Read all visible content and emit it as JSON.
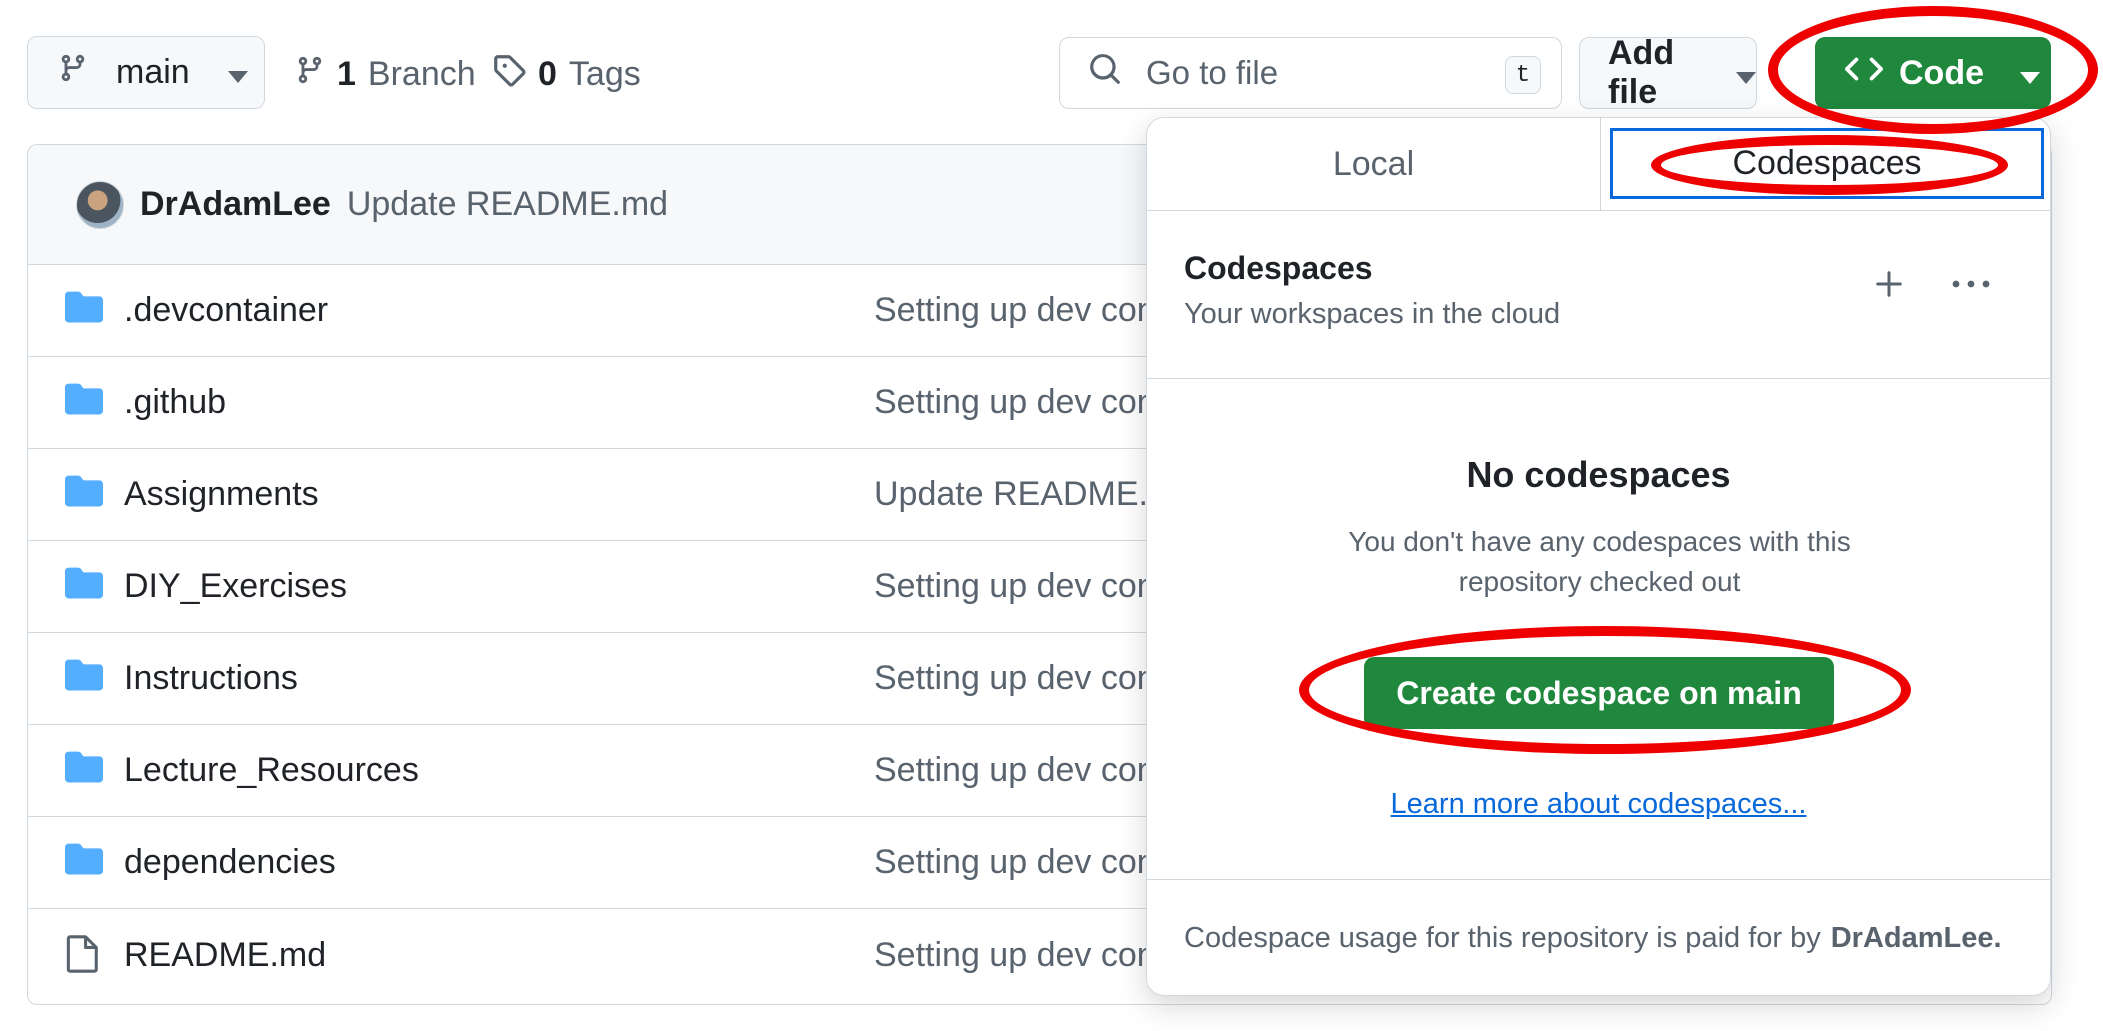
{
  "toolbar": {
    "branch_label": "main",
    "branches_count": "1",
    "branches_label": "Branch",
    "tags_count": "0",
    "tags_label": "Tags",
    "search_placeholder": "Go to file",
    "search_shortcut": "t",
    "add_file_label": "Add file",
    "code_label": "Code"
  },
  "latest_commit": {
    "author": "DrAdamLee",
    "message": "Update README.md"
  },
  "files": [
    {
      "name": ".devcontainer",
      "type": "folder",
      "message": "Setting up dev con"
    },
    {
      "name": ".github",
      "type": "folder",
      "message": "Setting up dev con"
    },
    {
      "name": "Assignments",
      "type": "folder",
      "message": "Update README.m"
    },
    {
      "name": "DIY_Exercises",
      "type": "folder",
      "message": "Setting up dev con"
    },
    {
      "name": "Instructions",
      "type": "folder",
      "message": "Setting up dev con"
    },
    {
      "name": "Lecture_Resources",
      "type": "folder",
      "message": "Setting up dev con"
    },
    {
      "name": "dependencies",
      "type": "folder",
      "message": "Setting up dev con"
    },
    {
      "name": "README.md",
      "type": "file",
      "message": "Setting up dev con"
    }
  ],
  "code_panel": {
    "tabs": [
      "Local",
      "Codespaces"
    ],
    "active_tab": "Codespaces",
    "section_title": "Codespaces",
    "section_subtitle": "Your workspaces in the cloud",
    "empty_title": "No codespaces",
    "empty_description": "You don't have any codespaces with this repository checked out",
    "create_button": "Create codespace on main",
    "learn_more_link": "Learn more about codespaces...",
    "footer_text": "Codespace usage for this repository is paid for by",
    "footer_owner": "DrAdamLee."
  },
  "colors": {
    "primary_green": "#1f883d",
    "link_blue": "#0969da",
    "folder_blue": "#54aeff",
    "annotation_red": "#ee0000"
  },
  "icons": {
    "branch": "git-branch-icon",
    "tag": "tag-icon",
    "search": "search-icon",
    "code": "code-brackets-icon",
    "folder": "folder-icon",
    "file": "file-icon",
    "plus": "plus-icon",
    "more": "kebab-horizontal-icon"
  }
}
